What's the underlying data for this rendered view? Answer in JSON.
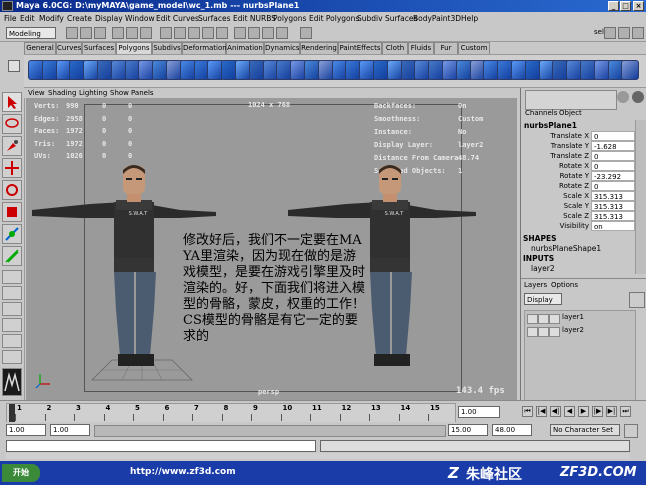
{
  "window": {
    "title": "Maya 6.0CG: D:\\myMAYA\\game_model\\wc_1.mb   ---   nurbsPlane1",
    "buttons": {
      "min": "_",
      "max": "□",
      "close": "×"
    }
  },
  "menubar": [
    "File",
    "Edit",
    "Modify",
    "Create",
    "Display",
    "Window",
    "Edit Curves",
    "Surfaces",
    "Edit NURBS",
    "Polygons",
    "Edit Polygons",
    "Subdiv Surfaces",
    "BodyPaint3D",
    "Help"
  ],
  "statusline": {
    "mode": "Modeling",
    "sel_label": "sel"
  },
  "shelf_tabs": [
    "General",
    "Curves",
    "Surfaces",
    "Polygons",
    "Subdivs",
    "Deformation",
    "Animation",
    "Dynamics",
    "Rendering",
    "PaintEffects",
    "Cloth",
    "Fluids",
    "Fur",
    "Custom"
  ],
  "active_shelf": "Polygons",
  "panel_menu": [
    "View",
    "Shading",
    "Lighting",
    "Show",
    "Panels"
  ],
  "hud": {
    "left_labels": [
      "Verts:",
      "Edges:",
      "Faces:",
      "Tris:",
      "UVs:"
    ],
    "left_values": [
      [
        "990",
        "0",
        "0"
      ],
      [
        "2958",
        "0",
        "0"
      ],
      [
        "1972",
        "0",
        "0"
      ],
      [
        "1972",
        "0",
        "0"
      ],
      [
        "1026",
        "0",
        "0"
      ]
    ],
    "resolution": "1024 x 768",
    "right_labels": [
      "Backfaces:",
      "Smoothness:",
      "Instance:",
      "Display Layer:",
      "Distance From Camera:",
      "Selected Objects:"
    ],
    "right_values": [
      "On",
      "Custom",
      "No",
      "layer2",
      "48.74",
      "1"
    ],
    "camera": "persp",
    "fps": "143.4 fps"
  },
  "overlay_text": "修改好后，我们不一定要在MAYA里渲染，因为现在做的是游戏模型，是要在游戏引擎里及时渲染的。好，下面我们将进入模型的骨骼，蒙皮，权重的工作！CS模型的骨骼是有它一定的要求的",
  "character": {
    "vest_text": "S.W.A.T"
  },
  "channel_box": {
    "tabs": [
      "Channels",
      "Object"
    ],
    "object": "nurbsPlane1",
    "attrs": [
      {
        "name": "Translate X",
        "value": "0"
      },
      {
        "name": "Translate Y",
        "value": "-1.628"
      },
      {
        "name": "Translate Z",
        "value": "0"
      },
      {
        "name": "Rotate X",
        "value": "0"
      },
      {
        "name": "Rotate Y",
        "value": "-23.292"
      },
      {
        "name": "Rotate Z",
        "value": "0"
      },
      {
        "name": "Scale X",
        "value": "315.313"
      },
      {
        "name": "Scale Y",
        "value": "315.313"
      },
      {
        "name": "Scale Z",
        "value": "315.313"
      },
      {
        "name": "Visibility",
        "value": "on"
      }
    ],
    "shapes_header": "SHAPES",
    "shape": "nurbsPlaneShape1",
    "inputs_header": "INPUTS",
    "input": "layer2"
  },
  "layers": {
    "menu": [
      "Layers",
      "Options"
    ],
    "display": "Display",
    "items": [
      "layer1",
      "layer2"
    ]
  },
  "timeline": {
    "ticks": [
      "1",
      "2",
      "3",
      "4",
      "5",
      "6",
      "7",
      "8",
      "9",
      "10",
      "11",
      "12",
      "13",
      "14",
      "15"
    ],
    "current": "1.00"
  },
  "range": {
    "start": "1.00",
    "inner_start": "1.00",
    "inner_end": "15.00",
    "end": "48.00",
    "character": "No Character Set"
  },
  "taskbar": {
    "start": "开始",
    "url": "http://www.zf3d.com",
    "brand": "朱峰社区",
    "site": "ZF3D.COM"
  },
  "colors": {
    "titlebar": "#0a2a8c",
    "viewport": "#9a9a9a",
    "taskbar": "#1a3ca8",
    "overlay_text": "#000000"
  }
}
